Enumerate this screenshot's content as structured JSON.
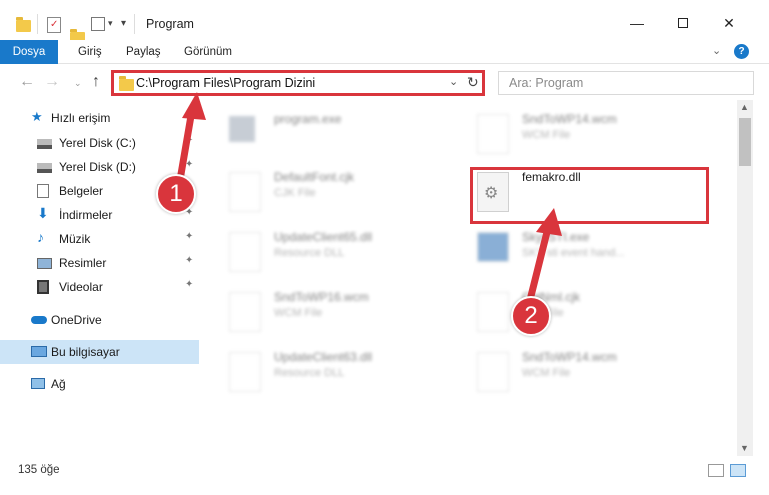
{
  "window": {
    "title": "Program",
    "minimize_icon": "minimize-icon",
    "maximize_icon": "maximize-icon",
    "close_icon": "close-icon"
  },
  "ribbon": {
    "file_tab": "Dosya",
    "tabs": [
      "Giriş",
      "Paylaş",
      "Görünüm"
    ]
  },
  "nav": {
    "address": "C:\\Program Files\\Program Dizini",
    "search_placeholder": "Ara: Program"
  },
  "sidebar": {
    "items": [
      {
        "label": "Hızlı erişim",
        "icon": "star-icon"
      },
      {
        "label": "Yerel Disk (C:)",
        "icon": "drive-icon",
        "pinned": true
      },
      {
        "label": "Yerel Disk (D:)",
        "icon": "drive-icon",
        "pinned": true
      },
      {
        "label": "Belgeler",
        "icon": "document-icon",
        "pinned": true
      },
      {
        "label": "İndirmeler",
        "icon": "download-icon",
        "pinned": true
      },
      {
        "label": "Müzik",
        "icon": "music-icon",
        "pinned": true
      },
      {
        "label": "Resimler",
        "icon": "picture-icon",
        "pinned": true
      },
      {
        "label": "Videolar",
        "icon": "video-icon",
        "pinned": true
      },
      {
        "label": "OneDrive",
        "icon": "cloud-icon"
      },
      {
        "label": "Bu bilgisayar",
        "icon": "computer-icon",
        "selected": true
      },
      {
        "label": "Ağ",
        "icon": "network-icon"
      }
    ]
  },
  "files": [
    {
      "name": "program.exe",
      "type": ""
    },
    {
      "name": "SndToWP14.wcm",
      "type": "WCM File"
    },
    {
      "name": "DefaultFont.cjk",
      "type": "CJK File"
    },
    {
      "name": "femakro.dll",
      "type": "",
      "highlighted": true
    },
    {
      "name": "UpdateClient65.dll",
      "type": "Resource DLL"
    },
    {
      "name": "SkyySTI.exe",
      "type": "SKY sti event hand..."
    },
    {
      "name": "SndToWP16.wcm",
      "type": "WCM File"
    },
    {
      "name": "ChtNml.cjk",
      "type": "CJK File"
    },
    {
      "name": "UpdateClient63.dll",
      "type": "Resource DLL"
    },
    {
      "name": "SndToWP14.wcm",
      "type": "WCM File"
    }
  ],
  "annotations": {
    "step1": "1",
    "step2": "2"
  },
  "status": {
    "count": "135 öğe"
  },
  "colors": {
    "accent": "#1979ca",
    "highlight": "#d9353c",
    "selection": "#cce4f7"
  }
}
